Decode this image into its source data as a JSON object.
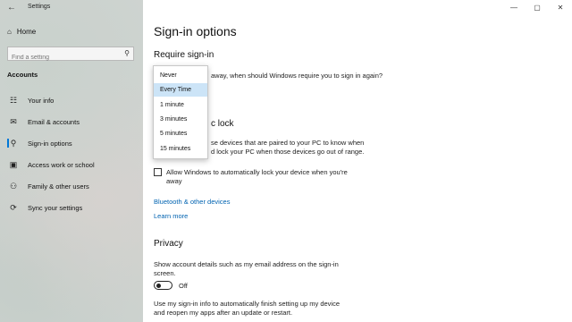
{
  "window": {
    "title": "Settings",
    "controls": {
      "minimize": "—",
      "maximize": "▢",
      "close": "✕"
    }
  },
  "sidebar": {
    "back_icon": "←",
    "home_label": "Home",
    "home_icon": "⌂",
    "search_placeholder": "Find a setting",
    "search_icon": "⚲",
    "section": "Accounts",
    "items": [
      {
        "label": "Your info",
        "icon": "person-card-icon",
        "glyph": "☷",
        "active": false
      },
      {
        "label": "Email & accounts",
        "icon": "mail-icon",
        "glyph": "✉",
        "active": false
      },
      {
        "label": "Sign-in options",
        "icon": "key-icon",
        "glyph": "⚲",
        "active": true
      },
      {
        "label": "Access work or school",
        "icon": "briefcase-icon",
        "glyph": "▣",
        "active": false
      },
      {
        "label": "Family & other users",
        "icon": "family-icon",
        "glyph": "⚇",
        "active": false
      },
      {
        "label": "Sync your settings",
        "icon": "sync-icon",
        "glyph": "⟳",
        "active": false
      }
    ]
  },
  "main": {
    "title": "Sign-in options",
    "require_signin": {
      "heading": "Require sign-in",
      "text": "away, when should Windows require you to sign in again?",
      "dropdown": {
        "options": [
          "Never",
          "Every Time",
          "1 minute",
          "3 minutes",
          "5 minutes",
          "15 minutes"
        ],
        "selected": "Every Time"
      }
    },
    "dynamic_lock": {
      "heading_fragment": "c lock",
      "text_line1": "se devices that are paired to your PC to know when",
      "text_line2": "d lock your PC when those devices go out of range.",
      "checkbox_label_line1": "Allow Windows to automatically lock your device when you're",
      "checkbox_label_line2": "away",
      "checked": false
    },
    "links": {
      "bluetooth": "Bluetooth & other devices",
      "learn_more": "Learn more"
    },
    "privacy": {
      "heading": "Privacy",
      "text_line1": "Show account details such as my email address on the sign-in",
      "text_line2": "screen.",
      "toggle_state": "Off",
      "text2_line1": "Use my sign-in info to automatically finish setting up my device",
      "text2_line2": "and reopen my apps after an update or restart."
    }
  }
}
